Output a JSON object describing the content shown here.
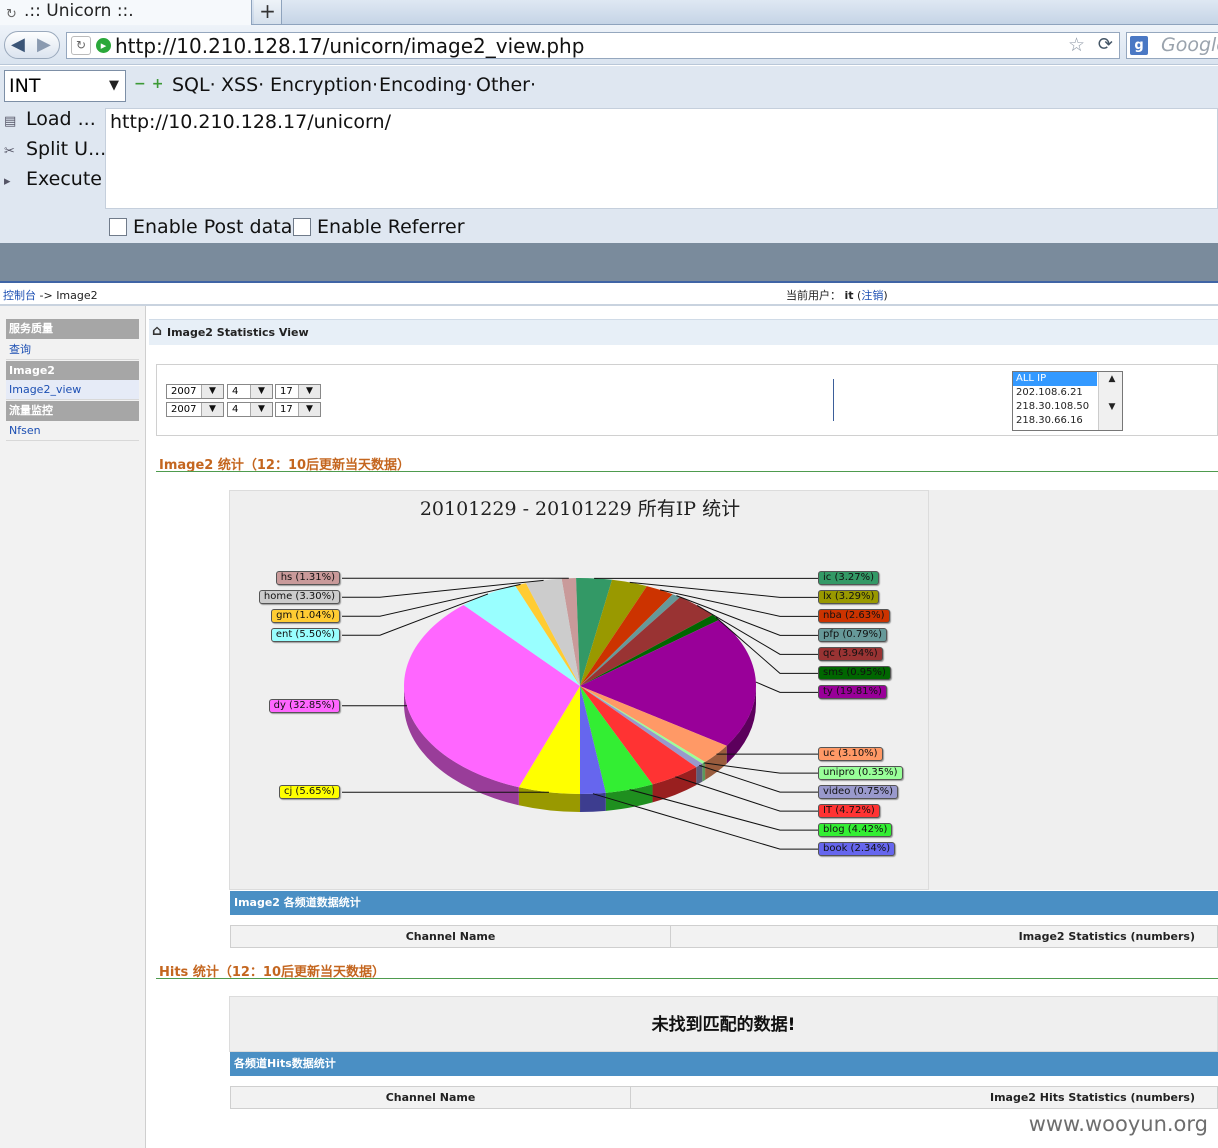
{
  "browser": {
    "tab_title": ".:: Unicorn ::.",
    "new_tab": "+",
    "url": "http://10.210.128.17/unicorn/image2_view.php",
    "search_placeholder": "Google"
  },
  "hackbar": {
    "select_value": "INT",
    "menus": [
      "SQL",
      "XSS",
      "Encryption",
      "Encoding",
      "Other"
    ],
    "buttons": [
      "Load ...",
      "Split U...",
      "Execute"
    ],
    "textarea_value": "http://10.210.128.17/unicorn/",
    "checkboxes": [
      "Enable Post data",
      "Enable Referrer"
    ]
  },
  "page": {
    "breadcrumb_root": "控制台",
    "breadcrumb_sep": " -> ",
    "breadcrumb_current": "Image2",
    "user_label": "当前用户：",
    "user_name": "it",
    "logout": "注销",
    "title": "Image2 Statistics View"
  },
  "sidebar": [
    {
      "type": "head",
      "label": "服务质量"
    },
    {
      "type": "item",
      "label": "查询"
    },
    {
      "type": "head",
      "label": "Image2"
    },
    {
      "type": "item",
      "label": "Image2_view",
      "selected": true
    },
    {
      "type": "head",
      "label": "流量监控"
    },
    {
      "type": "item",
      "label": "Nfsen"
    }
  ],
  "filters": {
    "start": {
      "year": "2007",
      "month": "4",
      "day": "17"
    },
    "end": {
      "year": "2007",
      "month": "4",
      "day": "17"
    },
    "ip_options": [
      "ALL IP",
      "202.108.6.21",
      "218.30.108.50",
      "218.30.66.16"
    ],
    "ip_selected": "ALL IP"
  },
  "section1_title": "Image2 统计（12：10后更新当天数据）",
  "section2_title": "Hits 统计（12：10后更新当天数据）",
  "chart_data": {
    "type": "pie",
    "title": "20101229 - 20101229   所有IP 统计",
    "slices": [
      {
        "label": "hs",
        "value": 1.31,
        "text": "hs (1.31%)",
        "color": "#c99a9a"
      },
      {
        "label": "ic",
        "value": 3.27,
        "text": "ic (3.27%)",
        "color": "#339966"
      },
      {
        "label": "lx",
        "value": 3.29,
        "text": "lx (3.29%)",
        "color": "#999900"
      },
      {
        "label": "nba",
        "value": 2.63,
        "text": "nba (2.63%)",
        "color": "#cc3300"
      },
      {
        "label": "pfp",
        "value": 0.79,
        "text": "pfp (0.79%)",
        "color": "#669999"
      },
      {
        "label": "qc",
        "value": 3.94,
        "text": "qc (3.94%)",
        "color": "#993333"
      },
      {
        "label": "sms",
        "value": 0.95,
        "text": "sms (0.95%)",
        "color": "#006600"
      },
      {
        "label": "ty",
        "value": 19.81,
        "text": "ty (19.81%)",
        "color": "#990099"
      },
      {
        "label": "uc",
        "value": 3.1,
        "text": "uc (3.10%)",
        "color": "#ff9966"
      },
      {
        "label": "unipro",
        "value": 0.35,
        "text": "unipro (0.35%)",
        "color": "#99ff99"
      },
      {
        "label": "video",
        "value": 0.75,
        "text": "video (0.75%)",
        "color": "#9999cc"
      },
      {
        "label": "IT",
        "value": 4.72,
        "text": "IT (4.72%)",
        "color": "#ff3333"
      },
      {
        "label": "blog",
        "value": 4.42,
        "text": "blog (4.42%)",
        "color": "#33ee33"
      },
      {
        "label": "book",
        "value": 2.34,
        "text": "book (2.34%)",
        "color": "#6666ee"
      },
      {
        "label": "cj",
        "value": 5.65,
        "text": "cj (5.65%)",
        "color": "#ffff00"
      },
      {
        "label": "dy",
        "value": 32.85,
        "text": "dy (32.85%)",
        "color": "#ff66ff"
      },
      {
        "label": "ent",
        "value": 5.5,
        "text": "ent (5.50%)",
        "color": "#99ffff"
      },
      {
        "label": "gm",
        "value": 1.04,
        "text": "gm (1.04%)",
        "color": "#ffcc33"
      },
      {
        "label": "home",
        "value": 3.3,
        "text": "home (3.30%)",
        "color": "#cccccc"
      }
    ]
  },
  "table1": {
    "bar_title": "Image2 各频道数据统计",
    "col1": "Channel Name",
    "col2": "Image2 Statistics (numbers)"
  },
  "nodata_text": "未找到匹配的数据!",
  "table2": {
    "bar_title": "各频道Hits数据统计",
    "col1": "Channel Name",
    "col2": "Image2 Hits Statistics (numbers)"
  },
  "watermark": "www.wooyun.org",
  "icons": {
    "back": "back-arrow-icon",
    "forward": "forward-arrow-icon",
    "home": "home-icon",
    "reload": "reload-icon",
    "bookmark": "star-icon"
  }
}
